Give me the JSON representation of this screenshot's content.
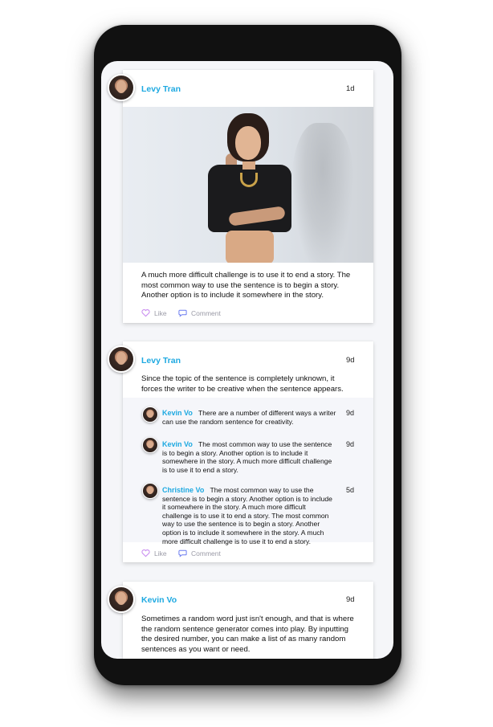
{
  "posts": [
    {
      "author": "Levy Tran",
      "time": "1d",
      "has_photo": true,
      "text_lines": [
        "A much more difficult challenge is to use it to end a story. The",
        "most common way to use the sentence is to begin a story.",
        "Another option is to include it somewhere in the story."
      ],
      "like_label": "Like",
      "comment_label": "Comment"
    },
    {
      "author": "Levy Tran",
      "time": "9d",
      "text_lines": [
        "Since the topic of the sentence is completely unknown, it",
        "forces the writer to be creative when the sentence appears."
      ],
      "replies": [
        {
          "author": "Kevin Vo",
          "time": "9d",
          "first_line": "There are a number of different ways a writer",
          "lines": [
            "can use the random sentence for creativity."
          ]
        },
        {
          "author": "Kevin Vo",
          "time": "9d",
          "first_line": "The most common way to use the sentence",
          "lines": [
            "is to begin a story. Another option is to include it",
            "somewhere in the story. A much more difficult challenge",
            "is to use it to end a story."
          ]
        },
        {
          "author": "Christine Vo",
          "time": "5d",
          "first_line": "The most common way to use the",
          "lines": [
            "sentence is to begin a story. Another option is to include",
            "it somewhere in the story. A much more difficult",
            "challenge is to use it to end a story. The most common",
            "way to use the sentence is to begin a story. Another",
            "option is to include it somewhere in the story. A much",
            "more difficult challenge is to use it to end a story."
          ]
        }
      ],
      "like_label": "Like",
      "comment_label": "Comment"
    },
    {
      "author": "Kevin Vo",
      "time": "9d",
      "text_lines": [
        "Sometimes a random word just isn't enough, and that is where",
        "the random sentence generator comes into play. By inputting",
        "the desired number, you can make a list of as many random",
        "sentences as you want or need."
      ]
    }
  ],
  "colors": {
    "accent": "#1ea9e1",
    "like_icon": "#c98df0",
    "comment_icon": "#6b7cf0",
    "muted_text": "#9a9aa6"
  },
  "icons": {
    "like": "heart-icon",
    "comment": "speech-bubble-icon"
  }
}
